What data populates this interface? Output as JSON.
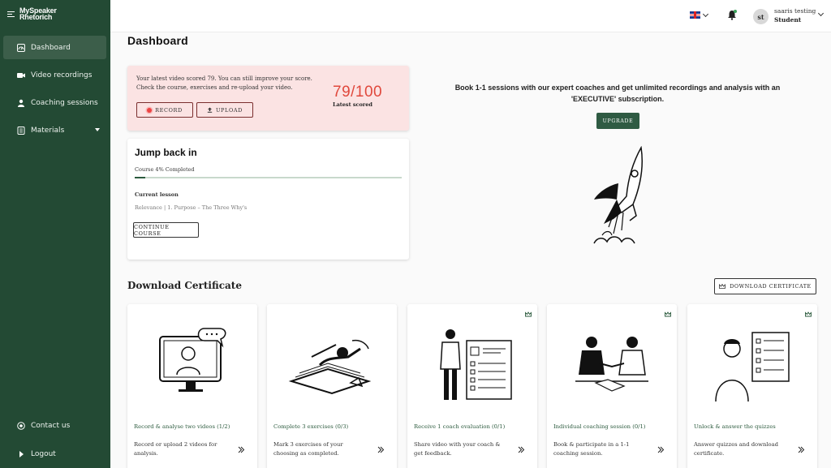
{
  "brand": {
    "line1": "MySpeaker",
    "line2": "Rhetorich"
  },
  "sidebar": {
    "items": [
      {
        "label": "Dashboard",
        "icon": "dashboard-icon"
      },
      {
        "label": "Video recordings",
        "icon": "video-camera-icon"
      },
      {
        "label": "Coaching sessions",
        "icon": "people-icon"
      },
      {
        "label": "Materials",
        "icon": "book-icon"
      }
    ],
    "bottom": [
      {
        "label": "Contact us",
        "icon": "chat-icon"
      },
      {
        "label": "Logout",
        "icon": "logout-icon"
      }
    ]
  },
  "topbar": {
    "language": "en-GB",
    "avatar_initials": "st",
    "user_name": "saaris testing",
    "user_role": "Student"
  },
  "page": {
    "title": "Dashboard"
  },
  "score_card": {
    "message": "Your latest video scored 79. You can still improve your score. Check the course, exercises and re-upload your video.",
    "record_label": "RECORD",
    "upload_label": "UPLOAD",
    "score": "79/100",
    "score_caption": "Latest scored"
  },
  "jump_back": {
    "title": "Jump back in",
    "progress_label": "Course 4% Completed",
    "progress_percent": 4,
    "current_lesson_label": "Current lesson",
    "current_lesson": "Relevance | 1. Purpose – The Three Why's",
    "continue_label": "CONTINUE COURSE"
  },
  "upsell": {
    "text": "Book 1-1 sessions with our expert coaches and get unlimited recordings and analysis with an 'EXECUTIVE' subscription.",
    "button": "UPGRADE"
  },
  "certificate": {
    "title": "Download Certificate",
    "download_label": "DOWNLOAD CERTIFICATE",
    "steps": [
      {
        "title": "Record & analyse two videos (1/2)",
        "desc": "Record or upload 2 videos for analysis.",
        "premium": false
      },
      {
        "title": "Complete 3 exercises (0/3)",
        "desc": "Mark 3 exercises of your choosing as completed.",
        "premium": false
      },
      {
        "title": "Receive 1 coach evaluation (0/1)",
        "desc": "Share video with your coach & get feedback.",
        "premium": true
      },
      {
        "title": "Individual coaching session (0/1)",
        "desc": "Book & participate in a 1-1 coaching session.",
        "premium": true
      },
      {
        "title": "Unlock & answer the quizzes",
        "desc": "Answer quizzes and download certificate.",
        "premium": true
      }
    ]
  },
  "colors": {
    "sidebar": "#234a34",
    "accent": "#2f5b43",
    "score": "#e0483c",
    "score_card_bg": "#fbe3e3"
  }
}
